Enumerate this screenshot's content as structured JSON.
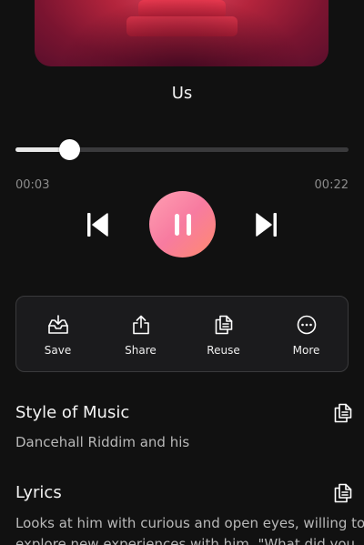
{
  "song": {
    "title": "Us"
  },
  "player": {
    "elapsed": "00:03",
    "total": "00:22",
    "progress_fraction": 0.16,
    "state": "playing"
  },
  "actions": [
    {
      "label": "Save",
      "icon": "save-icon"
    },
    {
      "label": "Share",
      "icon": "share-icon"
    },
    {
      "label": "Reuse",
      "icon": "reuse-icon"
    },
    {
      "label": "More",
      "icon": "more-icon"
    }
  ],
  "style_section": {
    "title": "Style of Music",
    "body": "Dancehall Riddim and his"
  },
  "lyrics_section": {
    "title": "Lyrics",
    "line1": "Looks at him with curious and open eyes, willing to",
    "line2": "explore new experiences with him. \"What did you"
  },
  "colors": {
    "background": "#111111",
    "play_gradient_start": "#ff9fb2",
    "play_gradient_end": "#ff8a6e",
    "panel_border": "#3a3a3c"
  }
}
